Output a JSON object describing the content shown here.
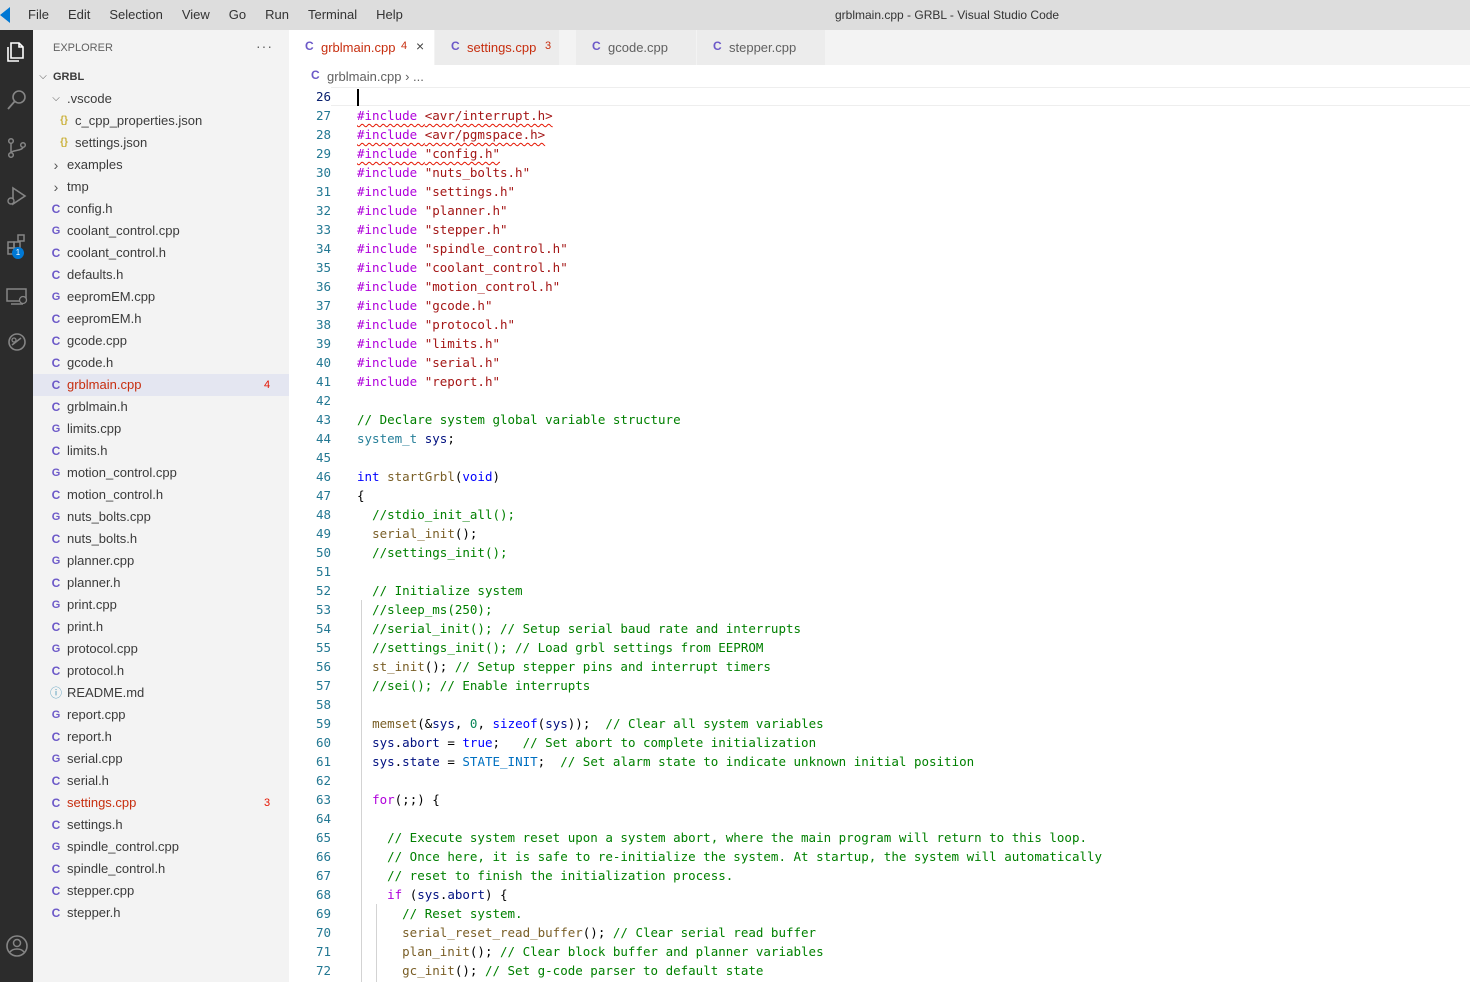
{
  "window": {
    "title": "grblmain.cpp - GRBL - Visual Studio Code",
    "menu": [
      "File",
      "Edit",
      "Selection",
      "View",
      "Go",
      "Run",
      "Terminal",
      "Help"
    ]
  },
  "activity_bar": {
    "items": [
      "explorer-icon",
      "search-icon",
      "source-control-icon",
      "run-debug-icon",
      "extensions-icon",
      "remote-explorer-icon",
      "gitlens-icon",
      "accounts-icon"
    ],
    "extensions_badge": "1"
  },
  "sidebar": {
    "title": "EXPLORER",
    "more": "···",
    "root": "GRBL",
    "items": [
      {
        "label": ".vscode",
        "kind": "folder-open",
        "depth": 1
      },
      {
        "label": "c_cpp_properties.json",
        "kind": "json",
        "depth": 2
      },
      {
        "label": "settings.json",
        "kind": "json",
        "depth": 2
      },
      {
        "label": "examples",
        "kind": "folder",
        "depth": 1
      },
      {
        "label": "tmp",
        "kind": "folder",
        "depth": 1
      },
      {
        "label": "config.h",
        "kind": "c",
        "depth": 1
      },
      {
        "label": "coolant_control.cpp",
        "kind": "cpp",
        "depth": 1
      },
      {
        "label": "coolant_control.h",
        "kind": "c",
        "depth": 1
      },
      {
        "label": "defaults.h",
        "kind": "c",
        "depth": 1
      },
      {
        "label": "eepromEM.cpp",
        "kind": "cpp",
        "depth": 1
      },
      {
        "label": "eepromEM.h",
        "kind": "c",
        "depth": 1
      },
      {
        "label": "gcode.cpp",
        "kind": "c",
        "depth": 1
      },
      {
        "label": "gcode.h",
        "kind": "c",
        "depth": 1
      },
      {
        "label": "grblmain.cpp",
        "kind": "c",
        "depth": 1,
        "selected": true,
        "errors": "4"
      },
      {
        "label": "grblmain.h",
        "kind": "c",
        "depth": 1
      },
      {
        "label": "limits.cpp",
        "kind": "cpp",
        "depth": 1
      },
      {
        "label": "limits.h",
        "kind": "c",
        "depth": 1
      },
      {
        "label": "motion_control.cpp",
        "kind": "cpp",
        "depth": 1
      },
      {
        "label": "motion_control.h",
        "kind": "c",
        "depth": 1
      },
      {
        "label": "nuts_bolts.cpp",
        "kind": "cpp",
        "depth": 1
      },
      {
        "label": "nuts_bolts.h",
        "kind": "c",
        "depth": 1
      },
      {
        "label": "planner.cpp",
        "kind": "cpp",
        "depth": 1
      },
      {
        "label": "planner.h",
        "kind": "c",
        "depth": 1
      },
      {
        "label": "print.cpp",
        "kind": "cpp",
        "depth": 1
      },
      {
        "label": "print.h",
        "kind": "c",
        "depth": 1
      },
      {
        "label": "protocol.cpp",
        "kind": "cpp",
        "depth": 1
      },
      {
        "label": "protocol.h",
        "kind": "c",
        "depth": 1
      },
      {
        "label": "README.md",
        "kind": "info",
        "depth": 1
      },
      {
        "label": "report.cpp",
        "kind": "cpp",
        "depth": 1
      },
      {
        "label": "report.h",
        "kind": "c",
        "depth": 1
      },
      {
        "label": "serial.cpp",
        "kind": "cpp",
        "depth": 1
      },
      {
        "label": "serial.h",
        "kind": "c",
        "depth": 1
      },
      {
        "label": "settings.cpp",
        "kind": "c",
        "depth": 1,
        "errors": "3",
        "error_label": true
      },
      {
        "label": "settings.h",
        "kind": "c",
        "depth": 1
      },
      {
        "label": "spindle_control.cpp",
        "kind": "cpp",
        "depth": 1
      },
      {
        "label": "spindle_control.h",
        "kind": "c",
        "depth": 1
      },
      {
        "label": "stepper.cpp",
        "kind": "c",
        "depth": 1
      },
      {
        "label": "stepper.h",
        "kind": "c",
        "depth": 1
      }
    ]
  },
  "tabs": [
    {
      "label": "grblmain.cpp",
      "count": "4",
      "active": true,
      "close": "×"
    },
    {
      "label": "settings.cpp",
      "count": "3",
      "active": false
    },
    {
      "label": "gcode.cpp",
      "count": "",
      "active": false
    },
    {
      "label": "stepper.cpp",
      "count": "",
      "active": false
    }
  ],
  "breadcrumb": {
    "file": "grblmain.cpp",
    "sep": "›",
    "rest": "..."
  },
  "editor": {
    "first_line": 26,
    "lines": [
      {
        "n": "26",
        "tokens": []
      },
      {
        "n": "27",
        "tokens": [
          [
            "pp squig",
            "#include "
          ],
          [
            "str squig",
            "<avr/interrupt.h>"
          ]
        ]
      },
      {
        "n": "28",
        "tokens": [
          [
            "pp squig",
            "#include "
          ],
          [
            "str squig",
            "<avr/pgmspace.h>"
          ]
        ]
      },
      {
        "n": "29",
        "tokens": [
          [
            "pp squig",
            "#include "
          ],
          [
            "str squig",
            "\"config.h\""
          ]
        ]
      },
      {
        "n": "30",
        "tokens": [
          [
            "pp",
            "#include "
          ],
          [
            "str",
            "\"nuts_bolts.h\""
          ]
        ]
      },
      {
        "n": "31",
        "tokens": [
          [
            "pp",
            "#include "
          ],
          [
            "str",
            "\"settings.h\""
          ]
        ]
      },
      {
        "n": "32",
        "tokens": [
          [
            "pp",
            "#include "
          ],
          [
            "str",
            "\"planner.h\""
          ]
        ]
      },
      {
        "n": "33",
        "tokens": [
          [
            "pp",
            "#include "
          ],
          [
            "str",
            "\"stepper.h\""
          ]
        ]
      },
      {
        "n": "34",
        "tokens": [
          [
            "pp",
            "#include "
          ],
          [
            "str",
            "\"spindle_control.h\""
          ]
        ]
      },
      {
        "n": "35",
        "tokens": [
          [
            "pp",
            "#include "
          ],
          [
            "str",
            "\"coolant_control.h\""
          ]
        ]
      },
      {
        "n": "36",
        "tokens": [
          [
            "pp",
            "#include "
          ],
          [
            "str",
            "\"motion_control.h\""
          ]
        ]
      },
      {
        "n": "37",
        "tokens": [
          [
            "pp",
            "#include "
          ],
          [
            "str",
            "\"gcode.h\""
          ]
        ]
      },
      {
        "n": "38",
        "tokens": [
          [
            "pp",
            "#include "
          ],
          [
            "str",
            "\"protocol.h\""
          ]
        ]
      },
      {
        "n": "39",
        "tokens": [
          [
            "pp",
            "#include "
          ],
          [
            "str",
            "\"limits.h\""
          ]
        ]
      },
      {
        "n": "40",
        "tokens": [
          [
            "pp",
            "#include "
          ],
          [
            "str",
            "\"serial.h\""
          ]
        ]
      },
      {
        "n": "41",
        "tokens": [
          [
            "pp",
            "#include "
          ],
          [
            "str",
            "\"report.h\""
          ]
        ]
      },
      {
        "n": "42",
        "tokens": []
      },
      {
        "n": "43",
        "tokens": [
          [
            "cm",
            "// Declare system global variable structure"
          ]
        ]
      },
      {
        "n": "44",
        "tokens": [
          [
            "ty",
            "system_t"
          ],
          [
            "",
            " "
          ],
          [
            "var",
            "sys"
          ],
          [
            "",
            ";"
          ]
        ]
      },
      {
        "n": "45",
        "tokens": []
      },
      {
        "n": "46",
        "tokens": [
          [
            "kw",
            "int"
          ],
          [
            "",
            " "
          ],
          [
            "fn",
            "startGrbl"
          ],
          [
            "",
            "("
          ],
          [
            "kw",
            "void"
          ],
          [
            "",
            ")"
          ]
        ]
      },
      {
        "n": "47",
        "tokens": [
          [
            "",
            "{"
          ]
        ]
      },
      {
        "n": "48",
        "tokens": [
          [
            "",
            "  "
          ],
          [
            "cm",
            "//stdio_init_all();"
          ]
        ]
      },
      {
        "n": "49",
        "tokens": [
          [
            "",
            "  "
          ],
          [
            "fn",
            "serial_init"
          ],
          [
            "",
            "();"
          ]
        ]
      },
      {
        "n": "50",
        "tokens": [
          [
            "",
            "  "
          ],
          [
            "cm",
            "//settings_init();"
          ]
        ]
      },
      {
        "n": "51",
        "tokens": []
      },
      {
        "n": "52",
        "tokens": [
          [
            "",
            "  "
          ],
          [
            "cm",
            "// Initialize system"
          ]
        ]
      },
      {
        "n": "53",
        "tokens": [
          [
            "",
            "  "
          ],
          [
            "cm",
            "//sleep_ms(250);"
          ]
        ]
      },
      {
        "n": "54",
        "tokens": [
          [
            "",
            "  "
          ],
          [
            "cm",
            "//serial_init(); // Setup serial baud rate and interrupts"
          ]
        ]
      },
      {
        "n": "55",
        "tokens": [
          [
            "",
            "  "
          ],
          [
            "cm",
            "//settings_init(); // Load grbl settings from EEPROM"
          ]
        ]
      },
      {
        "n": "56",
        "tokens": [
          [
            "",
            "  "
          ],
          [
            "fn",
            "st_init"
          ],
          [
            "",
            "(); "
          ],
          [
            "cm",
            "// Setup stepper pins and interrupt timers"
          ]
        ]
      },
      {
        "n": "57",
        "tokens": [
          [
            "",
            "  "
          ],
          [
            "cm",
            "//sei(); // Enable interrupts"
          ]
        ]
      },
      {
        "n": "58",
        "tokens": []
      },
      {
        "n": "59",
        "tokens": [
          [
            "",
            "  "
          ],
          [
            "fn",
            "memset"
          ],
          [
            "",
            "(&"
          ],
          [
            "var",
            "sys"
          ],
          [
            "",
            ", "
          ],
          [
            "num",
            "0"
          ],
          [
            "",
            ", "
          ],
          [
            "kw",
            "sizeof"
          ],
          [
            "",
            "("
          ],
          [
            "var",
            "sys"
          ],
          [
            "",
            "));  "
          ],
          [
            "cm",
            "// Clear all system variables"
          ]
        ]
      },
      {
        "n": "60",
        "tokens": [
          [
            "",
            "  "
          ],
          [
            "var",
            "sys"
          ],
          [
            "",
            "."
          ],
          [
            "var",
            "abort"
          ],
          [
            "",
            " = "
          ],
          [
            "kw",
            "true"
          ],
          [
            "",
            ";   "
          ],
          [
            "cm",
            "// Set abort to complete initialization"
          ]
        ]
      },
      {
        "n": "61",
        "tokens": [
          [
            "",
            "  "
          ],
          [
            "var",
            "sys"
          ],
          [
            "",
            "."
          ],
          [
            "var",
            "state"
          ],
          [
            "",
            " = "
          ],
          [
            "cst",
            "STATE_INIT"
          ],
          [
            "",
            ";  "
          ],
          [
            "cm",
            "// Set alarm state to indicate unknown initial position"
          ]
        ]
      },
      {
        "n": "62",
        "tokens": []
      },
      {
        "n": "63",
        "tokens": [
          [
            "",
            "  "
          ],
          [
            "pp",
            "for"
          ],
          [
            "",
            "(;;) {"
          ]
        ]
      },
      {
        "n": "64",
        "tokens": []
      },
      {
        "n": "65",
        "tokens": [
          [
            "",
            "    "
          ],
          [
            "cm",
            "// Execute system reset upon a system abort, where the main program will return to this loop."
          ]
        ]
      },
      {
        "n": "66",
        "tokens": [
          [
            "",
            "    "
          ],
          [
            "cm",
            "// Once here, it is safe to re-initialize the system. At startup, the system will automatically"
          ]
        ]
      },
      {
        "n": "67",
        "tokens": [
          [
            "",
            "    "
          ],
          [
            "cm",
            "// reset to finish the initialization process."
          ]
        ]
      },
      {
        "n": "68",
        "tokens": [
          [
            "",
            "    "
          ],
          [
            "pp",
            "if"
          ],
          [
            "",
            " ("
          ],
          [
            "var",
            "sys"
          ],
          [
            "",
            "."
          ],
          [
            "var",
            "abort"
          ],
          [
            "",
            ") {"
          ]
        ]
      },
      {
        "n": "69",
        "tokens": [
          [
            "",
            "      "
          ],
          [
            "cm",
            "// Reset system."
          ]
        ]
      },
      {
        "n": "70",
        "tokens": [
          [
            "",
            "      "
          ],
          [
            "fn",
            "serial_reset_read_buffer"
          ],
          [
            "",
            "(); "
          ],
          [
            "cm",
            "// Clear serial read buffer"
          ]
        ]
      },
      {
        "n": "71",
        "tokens": [
          [
            "",
            "      "
          ],
          [
            "fn",
            "plan_init"
          ],
          [
            "",
            "(); "
          ],
          [
            "cm",
            "// Clear block buffer and planner variables"
          ]
        ]
      },
      {
        "n": "72",
        "tokens": [
          [
            "",
            "      "
          ],
          [
            "fn",
            "gc_init"
          ],
          [
            "",
            "(); "
          ],
          [
            "cm",
            "// Set g-code parser to default state"
          ]
        ]
      }
    ]
  }
}
